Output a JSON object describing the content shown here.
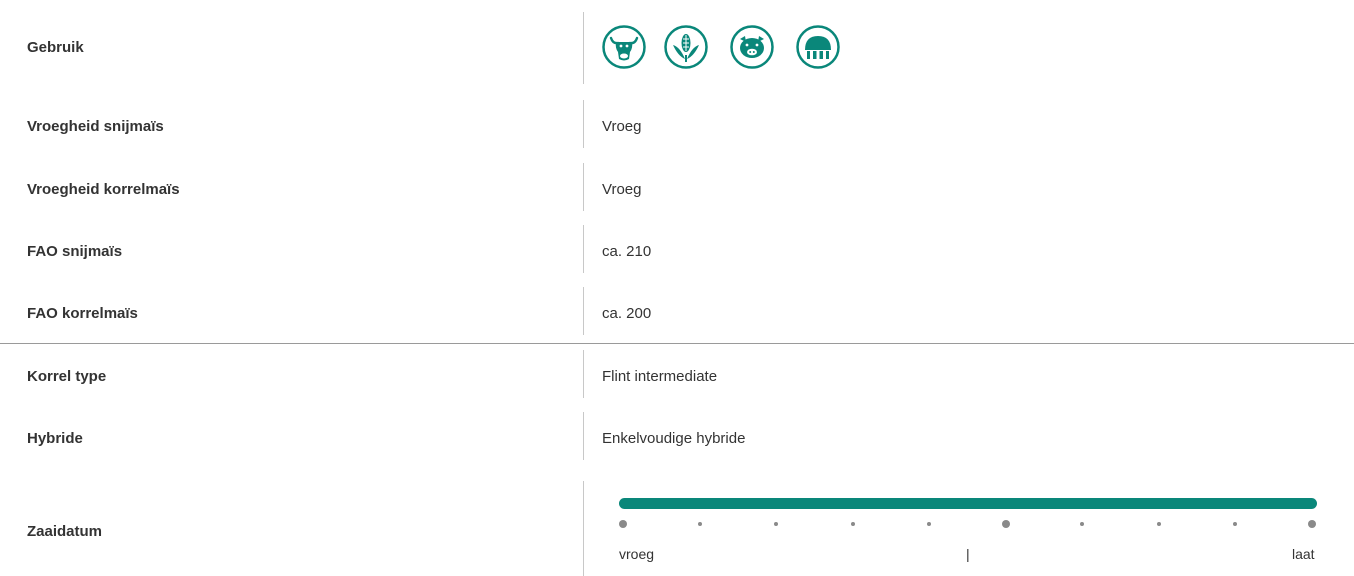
{
  "accent_color": "#0a877a",
  "rows": [
    {
      "label": "Gebruik",
      "value": ""
    },
    {
      "label": "Vroegheid snijmaïs",
      "value": "Vroeg"
    },
    {
      "label": "Vroegheid korrelmaïs",
      "value": "Vroeg"
    },
    {
      "label": "FAO snijmaïs",
      "value": "ca. 210"
    },
    {
      "label": "FAO korrelmaïs",
      "value": "ca. 200"
    },
    {
      "label": "Korrel type",
      "value": "Flint intermediate"
    },
    {
      "label": "Hybride",
      "value": "Enkelvoudige hybride"
    },
    {
      "label": "Zaaidatum",
      "value": ""
    }
  ],
  "usage_icons": [
    "cow-icon",
    "corn-icon",
    "pig-icon",
    "biogas-silo-icon"
  ],
  "sowing_scale": {
    "left_label": "vroeg",
    "middle_label": "|",
    "right_label": "laat",
    "range_fraction": [
      0,
      1
    ],
    "major_ticks": [
      0,
      5,
      9
    ],
    "tick_count": 10
  }
}
